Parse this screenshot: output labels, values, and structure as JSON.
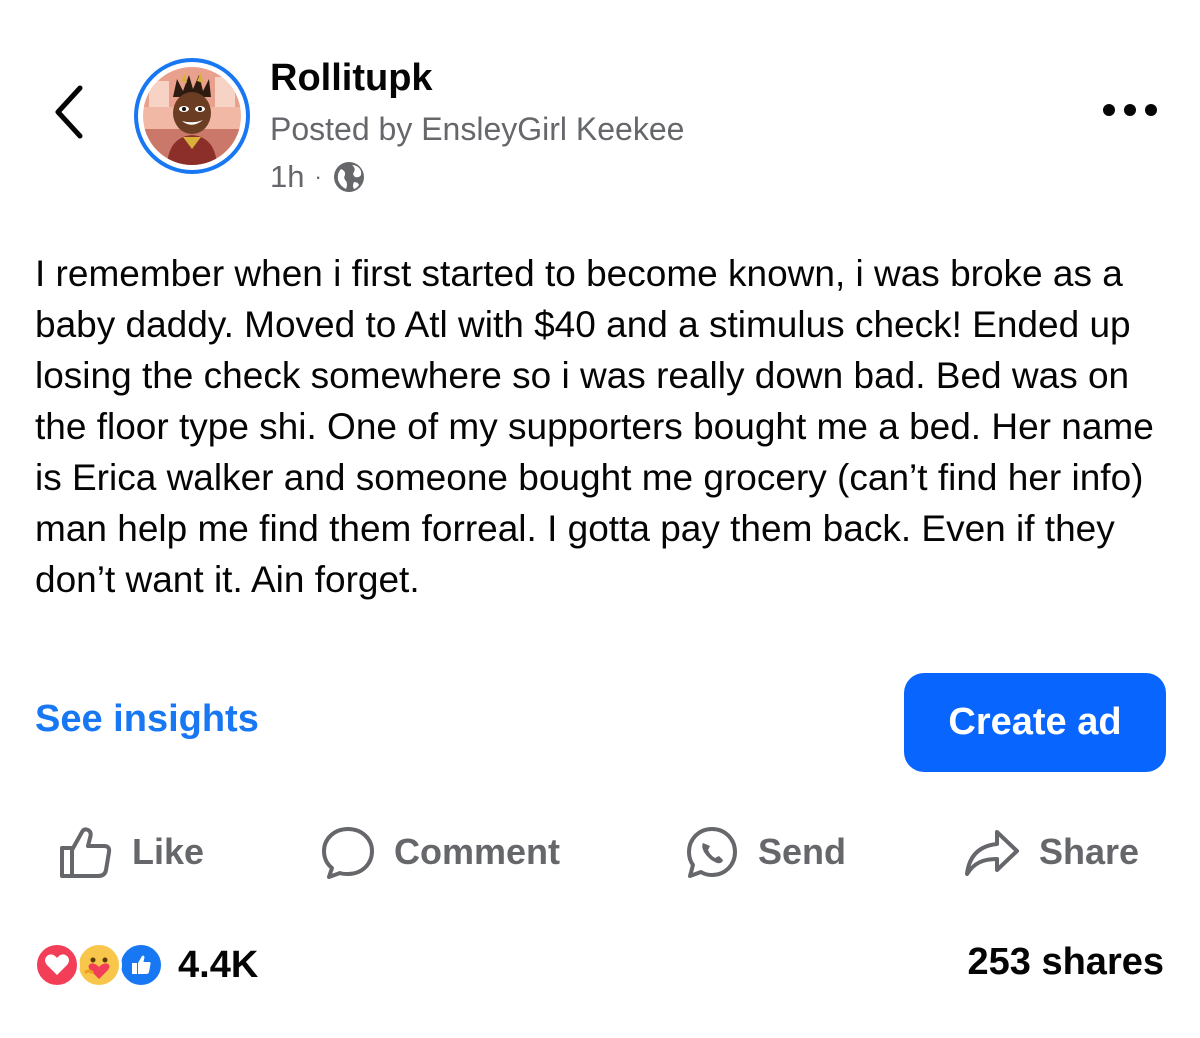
{
  "header": {
    "back_icon": "chevron-left-icon",
    "page_name": "Rollitupk",
    "posted_by": "Posted by EnsleyGirl Keekee",
    "time": "1h",
    "separator": "·",
    "audience_icon": "globe-icon",
    "more_icon": "more-horizontal-icon",
    "avatar_ring_color": "#1877f2"
  },
  "post": {
    "text": "I remember when i first started to become known, i was broke as a baby daddy. Moved to Atl with $40 and a stimulus check! Ended up losing the check somewhere so i was really down bad. Bed was on the floor type shi. One of my supporters bought me a bed. Her name is Erica walker and someone bought me grocery (can’t find her info) man help me find them forreal. I gotta pay them back. Even if they don’t want it. Ain forget."
  },
  "cta": {
    "see_insights": "See insights",
    "create_ad": "Create ad",
    "accent_color": "#1877f2",
    "button_color": "#0866ff"
  },
  "actions": [
    {
      "label": "Like",
      "icon": "thumbs-up-icon"
    },
    {
      "label": "Comment",
      "icon": "comment-bubble-icon"
    },
    {
      "label": "Send",
      "icon": "messenger-send-icon"
    },
    {
      "label": "Share",
      "icon": "share-arrow-icon"
    }
  ],
  "footer": {
    "reaction_icons": [
      "love-reaction-icon",
      "care-reaction-icon",
      "like-reaction-icon"
    ],
    "reaction_count": "4.4K",
    "shares": "253 shares"
  }
}
